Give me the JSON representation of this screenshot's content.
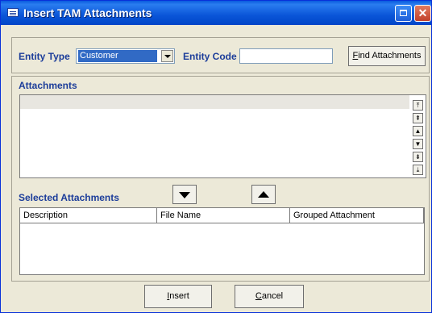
{
  "window": {
    "title": "Insert TAM Attachments",
    "accent": "#0a55d8"
  },
  "criteria": {
    "entity_type_label": "Entity Type",
    "entity_type_value": "Customer",
    "entity_code_label": "Entity Code",
    "entity_code_value": "",
    "find_button_label": "Find Attachments"
  },
  "attachments": {
    "label": "Attachments",
    "scroll_buttons": [
      "top",
      "page-up",
      "up",
      "down",
      "page-down",
      "bottom"
    ]
  },
  "selected": {
    "label": "Selected Attachments",
    "columns": [
      "Description",
      "File Name",
      "Grouped Attachment"
    ],
    "rows": []
  },
  "actions": {
    "insert_label": "Insert",
    "cancel_label": "Cancel"
  }
}
